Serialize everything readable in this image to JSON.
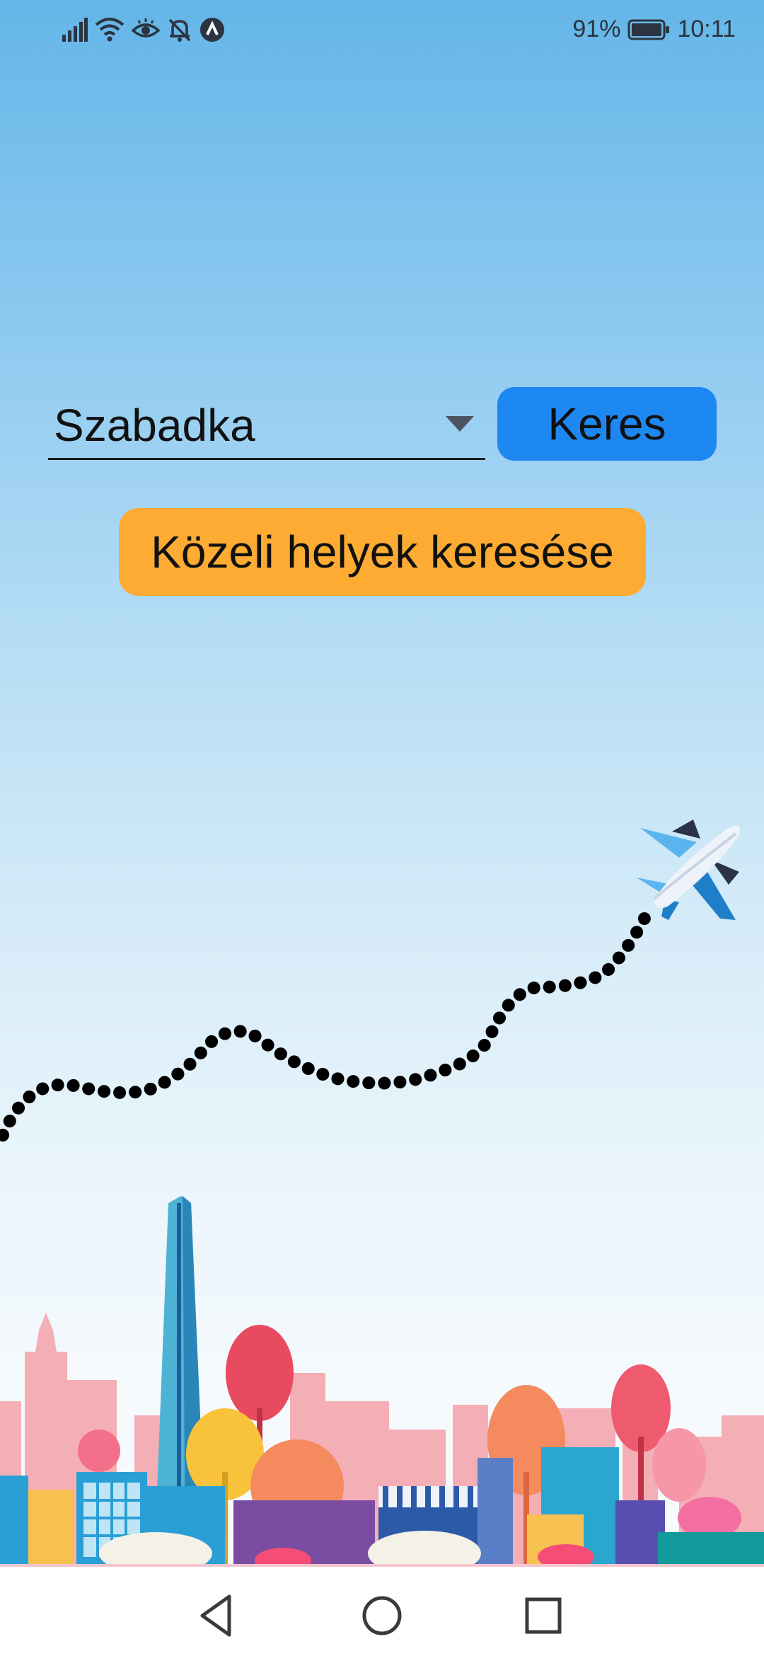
{
  "status_bar": {
    "battery": "91%",
    "time": "10:11",
    "icons": [
      "signal-icon",
      "wifi-icon",
      "eye-comfort-icon",
      "mute-bell-icon",
      "app-notification-icon",
      "battery-icon"
    ]
  },
  "search": {
    "city_value": "Szabadka",
    "search_label": "Keres"
  },
  "nearby": {
    "label": "Közeli helyek keresése"
  },
  "colors": {
    "search_button": "#1e88f2",
    "nearby_button": "#fdab33",
    "sky_top": "#64b6e8"
  },
  "nav": {
    "icons": [
      "back-icon",
      "home-icon",
      "recents-icon"
    ]
  }
}
